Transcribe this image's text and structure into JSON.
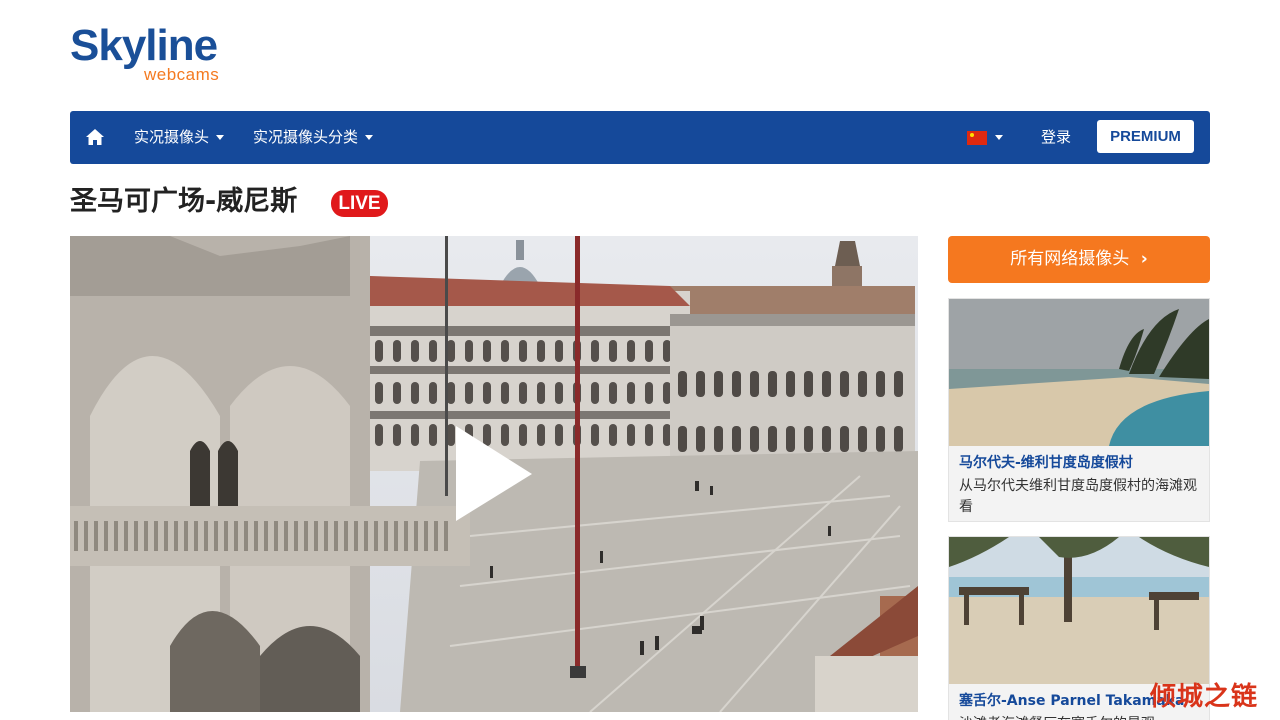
{
  "logo": {
    "main": "Skyline",
    "sub": "webcams"
  },
  "nav": {
    "home_icon": "home-icon",
    "live_cams": "实况摄像头",
    "categories": "实况摄像头分类",
    "language_flag": "china-flag-icon",
    "login": "登录",
    "premium": "PREMIUM"
  },
  "page": {
    "title": "圣马可广场-威尼斯",
    "live_badge": "LIVE"
  },
  "video": {
    "play_icon": "play-icon"
  },
  "sidebar": {
    "all_webcams": "所有网络摄像头",
    "cards": [
      {
        "title": "马尔代夫-维利甘度岛度假村",
        "desc": "从马尔代夫维利甘度岛度假村的海滩观看"
      },
      {
        "title": "塞舌尔-Anse Parnel Takamaka",
        "desc": "沙滩者海滩餐厅在塞舌尔的景观"
      }
    ]
  },
  "watermark": "倾城之链",
  "colors": {
    "brand_blue": "#15499a",
    "accent_orange": "#f5781f",
    "live_red": "#e0191b"
  }
}
